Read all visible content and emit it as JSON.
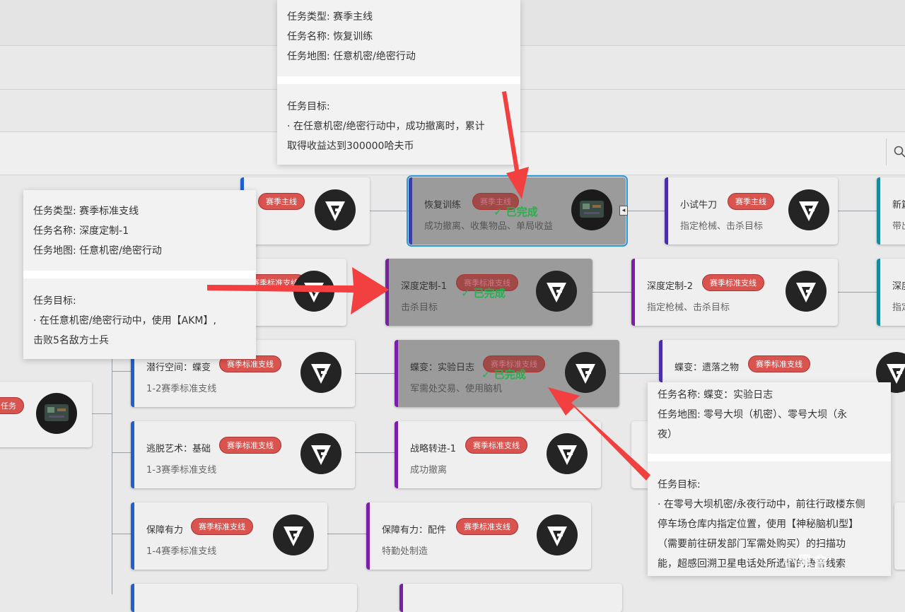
{
  "colors": {
    "badge": "#d9534f",
    "done_text": "#27b04d",
    "blue_border": "#1f5fcf",
    "purple_border": "#7a1fa8",
    "arrow": "#f24040"
  },
  "tooltip_top": {
    "type": "任务类型: 赛季主线",
    "name": "任务名称: 恢复训练",
    "map": "任务地图: 任意机密/绝密行动",
    "goal_label": "任务目标:",
    "goal_line1": "· 在任意机密/绝密行动中，成功撤离时，累计",
    "goal_line2": "取得收益达到300000哈夫币"
  },
  "tooltip_left": {
    "type": "任务类型: 赛季标准支线",
    "name": "任务名称: 深度定制-1",
    "map": "任务地图: 任意机密/绝密行动",
    "goal_label": "任务目标:",
    "goal_line1": "· 在任意机密/绝密行动中，使用【AKM】,",
    "goal_line2": "击败5名敌方士兵"
  },
  "tooltip_right": {
    "name": "任务名称: 蝶变：实验日志",
    "map1": "任务地图: 零号大坝（机密）、零号大坝（永",
    "map2": "夜）",
    "goal_label": "任务目标:",
    "goal_line1": "· 在零号大坝机密/永夜行动中，前往行政楼东侧",
    "goal_line2": "停车场仓库内指定位置，使用【神秘脑机I型】",
    "goal_line3": "（需要前往研发部门军需处购买）的扫描功",
    "goal_line4": "能，超感回溯卫星电话处所遗留的语音线索"
  },
  "cards": {
    "c_main_left": {
      "badge": "赛季主线"
    },
    "c_recover": {
      "title": "恢复训练",
      "badge": "赛季主线",
      "sub": "成功撤离、收集物品、单局收益",
      "stamp": "✓ 已完成"
    },
    "c_xiaoshi": {
      "title": "小试牛刀",
      "badge": "赛季主线",
      "sub": "指定枪械、击杀目标"
    },
    "c_new": {
      "title": "新篇",
      "sub": "带出"
    },
    "c_depth1": {
      "title": "深度定制-1",
      "badge": "赛季标准支线",
      "sub": "击杀目标",
      "stamp": "✓ 已完成"
    },
    "c_depth2": {
      "title": "深度定制-2",
      "badge": "赛季标准支线",
      "sub": "指定枪械、击杀目标"
    },
    "c_depth3": {
      "title": "深度",
      "sub": "指定"
    },
    "c_mid_left": {
      "badge": "赛季标准支线"
    },
    "c_qianxing": {
      "title": "潜行空间：蝶变",
      "badge": "赛季标准支线",
      "sub": "1-2赛季标准支线"
    },
    "c_diebian_log": {
      "title": "蝶变：实验日志",
      "badge": "赛季标准支线",
      "sub": "军需处交易、使用脑机",
      "stamp": "✓ 已完成"
    },
    "c_diebian_relic": {
      "title": "蝶变：遗落之物",
      "badge": "赛季标准支线"
    },
    "c_root": {
      "badge": "任务"
    },
    "c_escape": {
      "title": "逃脱艺术：基础",
      "badge": "赛季标准支线",
      "sub": "1-3赛季标准支线"
    },
    "c_zhanlue": {
      "title": "战略转进-1",
      "badge": "赛季标准支线",
      "sub": "成功撤离"
    },
    "c_baozhang1": {
      "title": "保障有力",
      "badge": "赛季标准支线",
      "sub": "1-4赛季标准支线"
    },
    "c_baozhang2": {
      "title": "保障有力：配件",
      "badge": "赛季标准支线",
      "sub": "特勤处制造"
    }
  },
  "watermark": "小黑盒"
}
